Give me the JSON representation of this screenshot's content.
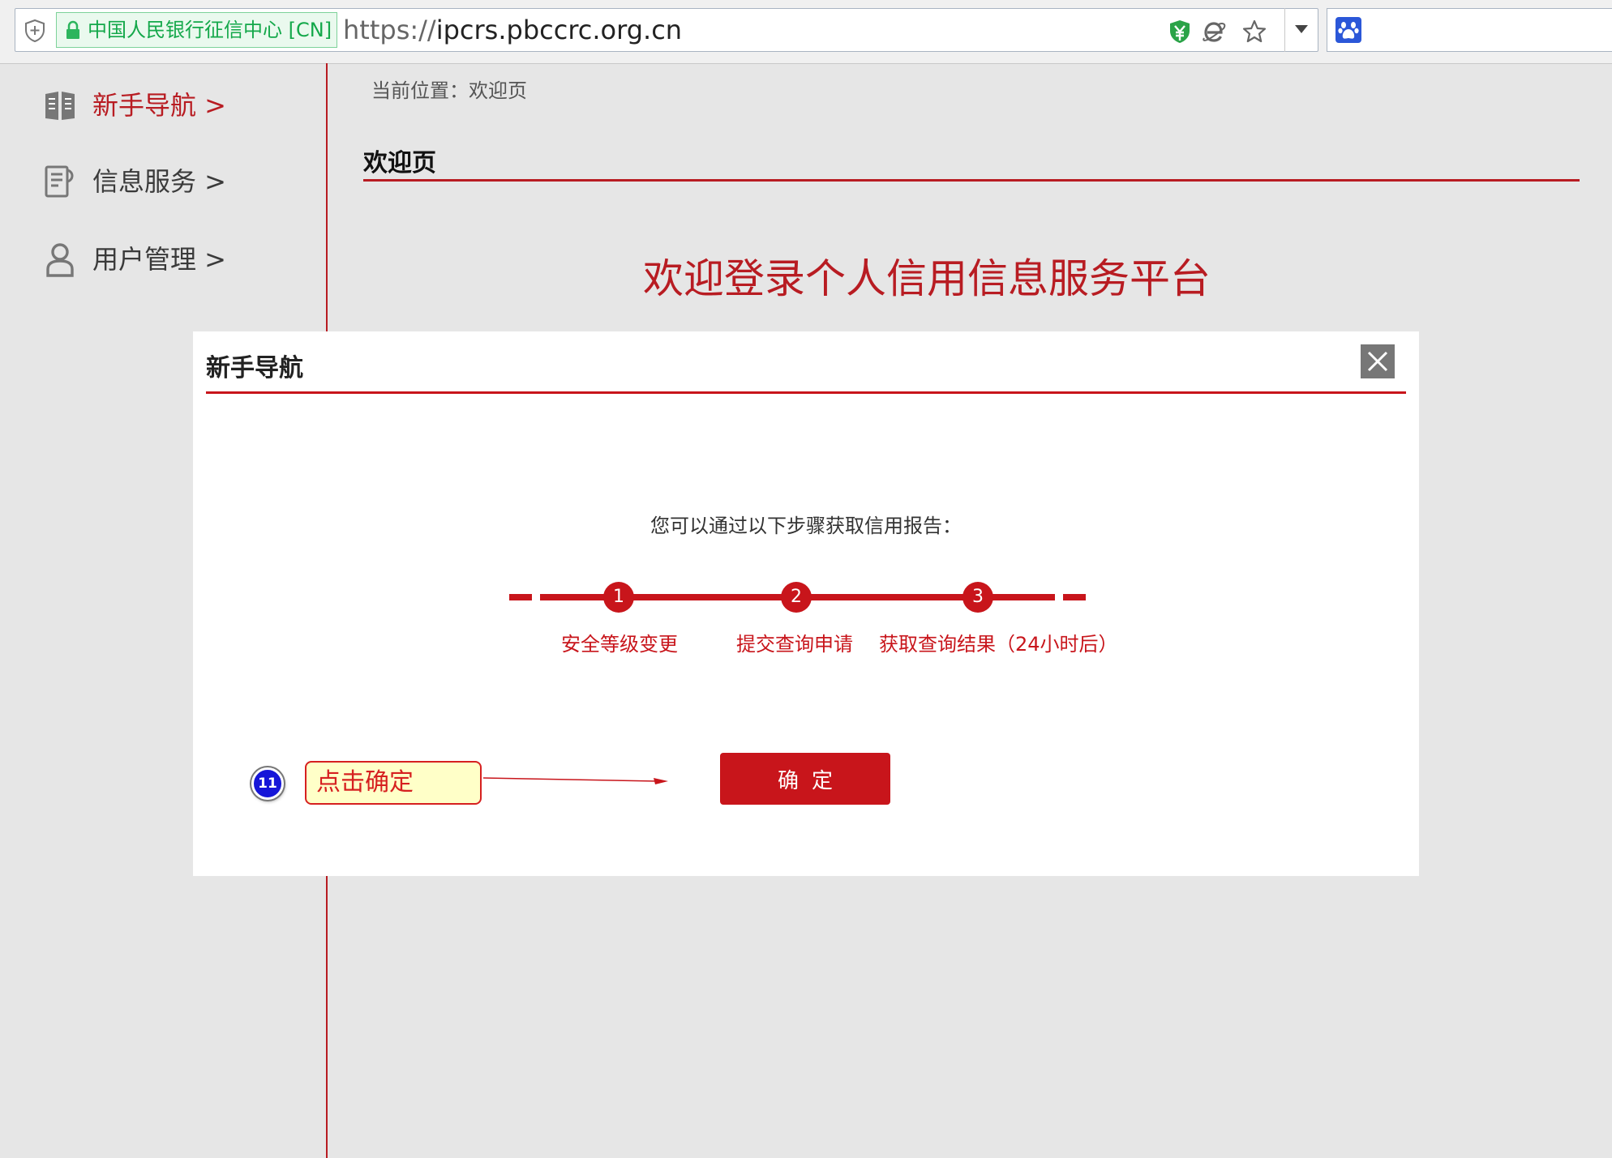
{
  "browser": {
    "site_identity": "中国人民银行征信中心 [CN]",
    "url_protocol": "https://",
    "url_host": "ipcrs.pbccrc.org.cn"
  },
  "sidebar": {
    "items": [
      {
        "label": "新手导航 >",
        "icon": "book-icon"
      },
      {
        "label": "信息服务 >",
        "icon": "document-icon"
      },
      {
        "label": "用户管理 >",
        "icon": "user-icon"
      }
    ]
  },
  "main": {
    "breadcrumb": "当前位置：欢迎页",
    "title": "欢迎页",
    "welcome": "欢迎登录个人信用信息服务平台"
  },
  "modal": {
    "title": "新手导航",
    "intro": "您可以通过以下步骤获取信用报告：",
    "steps": [
      {
        "number": "1",
        "label": "安全等级变更"
      },
      {
        "number": "2",
        "label": "提交查询申请"
      },
      {
        "number": "3",
        "label": "获取查询结果（24小时后）"
      }
    ],
    "confirm_label": "确定"
  },
  "annotation": {
    "number": "11",
    "text": "点击确定"
  },
  "colors": {
    "accent_red": "#b81c22",
    "button_red": "#c8151b",
    "annotation_blue": "#1616d8",
    "secure_green": "#14a84a"
  }
}
